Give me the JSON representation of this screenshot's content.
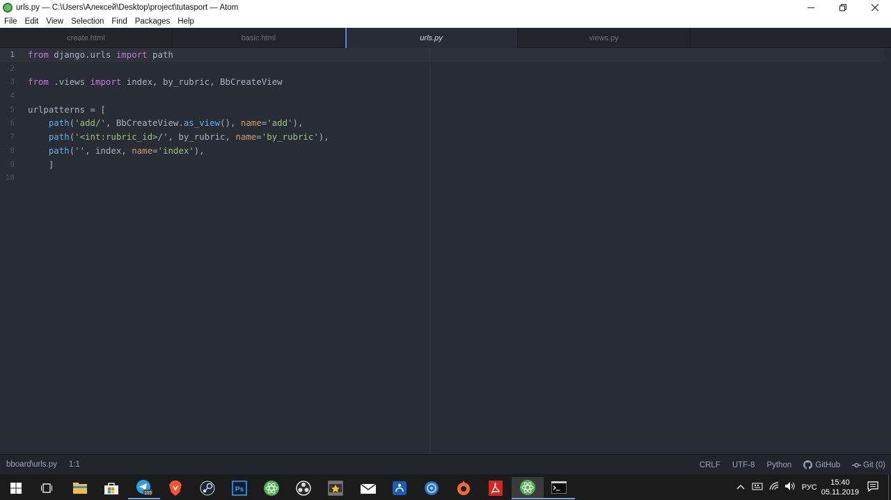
{
  "window": {
    "title": "urls.py — C:\\Users\\Алексей\\Desktop\\project\\tutasport — Atom",
    "controls": [
      "minimize-icon",
      "restore-icon",
      "close-icon"
    ]
  },
  "menu": [
    "File",
    "Edit",
    "View",
    "Selection",
    "Find",
    "Packages",
    "Help"
  ],
  "tabs": [
    {
      "label": "create.html",
      "active": false
    },
    {
      "label": "basic.html",
      "active": false
    },
    {
      "label": "urls.py",
      "active": true
    },
    {
      "label": "views.py",
      "active": false
    }
  ],
  "editor": {
    "line_numbers": [
      "1",
      "2",
      "3",
      "4",
      "5",
      "6",
      "7",
      "8",
      "9",
      "10"
    ],
    "lines": [
      "from django.urls import path",
      "",
      "from .views import index, by_rubric, BbCreateView",
      "",
      "urlpatterns = [",
      "    path('add/', BbCreateView.as_view(), name='add'),",
      "    path('<int:rubric_id>/', by_rubric, name='by_rubric'),",
      "    path('', index, name='index'),",
      "    ]",
      ""
    ],
    "active_line": 1,
    "colors": {
      "keyword": "#c678dd",
      "string": "#98c379",
      "function": "#61afef",
      "parameter": "#d19a66",
      "text": "#abb2bf"
    }
  },
  "status": {
    "file_path": "bboard\\urls.py",
    "cursor_position": "1:1",
    "line_ending": "CRLF",
    "encoding": "UTF-8",
    "grammar": "Python",
    "github": "GitHub",
    "git": "Git (0)"
  },
  "taskbar": {
    "apps": [
      "windows-start-icon",
      "task-view-icon",
      "file-explorer-icon",
      "store-icon",
      "telegram-icon",
      "brave-icon",
      "steam-icon",
      "photoshop-icon",
      "atom-icon",
      "obs-icon",
      "movie-maker-icon",
      "mail-icon",
      "fiddler-icon",
      "circle-app-icon",
      "origin-icon",
      "acrobat-icon",
      "atom-active-icon",
      "terminal-icon"
    ],
    "telegram_badge": "103",
    "photoshop_label": "Ps",
    "language": "РУС",
    "time": "15:40",
    "date": "05.11.2019"
  }
}
